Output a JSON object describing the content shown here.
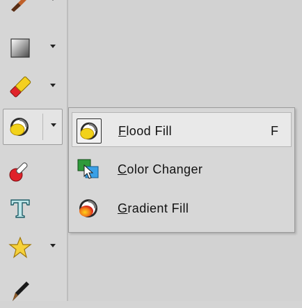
{
  "toolbar": {
    "tools": [
      {
        "name": "brush-tool",
        "icon": "brush-icon",
        "has_menu": true
      },
      {
        "name": "rectangle-tool",
        "icon": "gradient-rectangle-icon",
        "has_menu": true
      },
      {
        "name": "eraser-tool",
        "icon": "eraser-icon",
        "has_menu": true
      },
      {
        "name": "fill-tool",
        "icon": "flood-fill-icon",
        "has_menu": true,
        "active": true
      },
      {
        "name": "eyedropper-tool",
        "icon": "eyedropper-icon",
        "has_menu": false
      },
      {
        "name": "text-tool",
        "icon": "text-icon",
        "has_menu": false
      },
      {
        "name": "shape-tool",
        "icon": "star-icon",
        "has_menu": true
      },
      {
        "name": "pen-tool",
        "icon": "pen-icon",
        "has_menu": false
      }
    ]
  },
  "fill_menu": {
    "items": [
      {
        "mnemonic": "F",
        "rest": "lood Fill",
        "shortcut": "F",
        "icon": "flood-fill-icon",
        "highlighted": true
      },
      {
        "mnemonic": "C",
        "rest": "olor Changer",
        "shortcut": "",
        "icon": "color-changer-icon"
      },
      {
        "mnemonic": "G",
        "rest": "radient Fill",
        "shortcut": "",
        "icon": "gradient-fill-icon"
      }
    ]
  },
  "colors": {
    "toolbar_bg": "#d6d6d6",
    "menu_bg": "#d7d7d7",
    "highlight_bg": "#e9e9e9"
  }
}
